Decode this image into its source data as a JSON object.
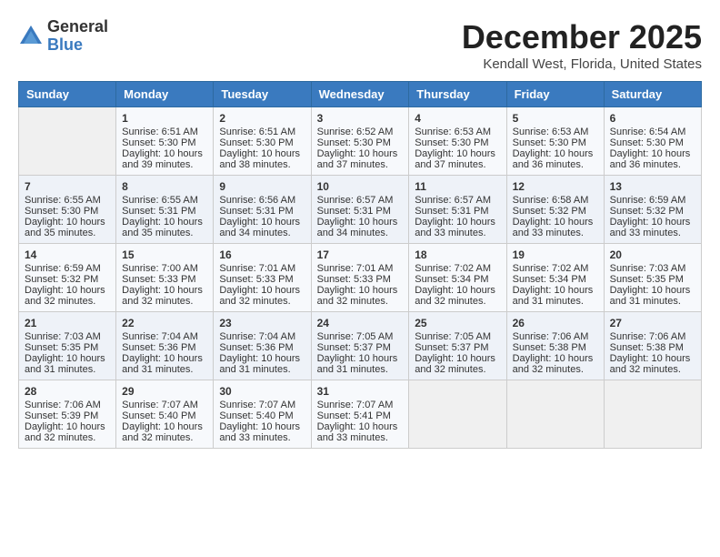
{
  "header": {
    "logo": {
      "general": "General",
      "blue": "Blue"
    },
    "title": "December 2025",
    "location": "Kendall West, Florida, United States"
  },
  "days_of_week": [
    "Sunday",
    "Monday",
    "Tuesday",
    "Wednesday",
    "Thursday",
    "Friday",
    "Saturday"
  ],
  "weeks": [
    [
      {
        "day": "",
        "content": ""
      },
      {
        "day": "1",
        "content": "Sunrise: 6:51 AM\nSunset: 5:30 PM\nDaylight: 10 hours\nand 39 minutes."
      },
      {
        "day": "2",
        "content": "Sunrise: 6:51 AM\nSunset: 5:30 PM\nDaylight: 10 hours\nand 38 minutes."
      },
      {
        "day": "3",
        "content": "Sunrise: 6:52 AM\nSunset: 5:30 PM\nDaylight: 10 hours\nand 37 minutes."
      },
      {
        "day": "4",
        "content": "Sunrise: 6:53 AM\nSunset: 5:30 PM\nDaylight: 10 hours\nand 37 minutes."
      },
      {
        "day": "5",
        "content": "Sunrise: 6:53 AM\nSunset: 5:30 PM\nDaylight: 10 hours\nand 36 minutes."
      },
      {
        "day": "6",
        "content": "Sunrise: 6:54 AM\nSunset: 5:30 PM\nDaylight: 10 hours\nand 36 minutes."
      }
    ],
    [
      {
        "day": "7",
        "content": "Sunrise: 6:55 AM\nSunset: 5:30 PM\nDaylight: 10 hours\nand 35 minutes."
      },
      {
        "day": "8",
        "content": "Sunrise: 6:55 AM\nSunset: 5:31 PM\nDaylight: 10 hours\nand 35 minutes."
      },
      {
        "day": "9",
        "content": "Sunrise: 6:56 AM\nSunset: 5:31 PM\nDaylight: 10 hours\nand 34 minutes."
      },
      {
        "day": "10",
        "content": "Sunrise: 6:57 AM\nSunset: 5:31 PM\nDaylight: 10 hours\nand 34 minutes."
      },
      {
        "day": "11",
        "content": "Sunrise: 6:57 AM\nSunset: 5:31 PM\nDaylight: 10 hours\nand 33 minutes."
      },
      {
        "day": "12",
        "content": "Sunrise: 6:58 AM\nSunset: 5:32 PM\nDaylight: 10 hours\nand 33 minutes."
      },
      {
        "day": "13",
        "content": "Sunrise: 6:59 AM\nSunset: 5:32 PM\nDaylight: 10 hours\nand 33 minutes."
      }
    ],
    [
      {
        "day": "14",
        "content": "Sunrise: 6:59 AM\nSunset: 5:32 PM\nDaylight: 10 hours\nand 32 minutes."
      },
      {
        "day": "15",
        "content": "Sunrise: 7:00 AM\nSunset: 5:33 PM\nDaylight: 10 hours\nand 32 minutes."
      },
      {
        "day": "16",
        "content": "Sunrise: 7:01 AM\nSunset: 5:33 PM\nDaylight: 10 hours\nand 32 minutes."
      },
      {
        "day": "17",
        "content": "Sunrise: 7:01 AM\nSunset: 5:33 PM\nDaylight: 10 hours\nand 32 minutes."
      },
      {
        "day": "18",
        "content": "Sunrise: 7:02 AM\nSunset: 5:34 PM\nDaylight: 10 hours\nand 32 minutes."
      },
      {
        "day": "19",
        "content": "Sunrise: 7:02 AM\nSunset: 5:34 PM\nDaylight: 10 hours\nand 31 minutes."
      },
      {
        "day": "20",
        "content": "Sunrise: 7:03 AM\nSunset: 5:35 PM\nDaylight: 10 hours\nand 31 minutes."
      }
    ],
    [
      {
        "day": "21",
        "content": "Sunrise: 7:03 AM\nSunset: 5:35 PM\nDaylight: 10 hours\nand 31 minutes."
      },
      {
        "day": "22",
        "content": "Sunrise: 7:04 AM\nSunset: 5:36 PM\nDaylight: 10 hours\nand 31 minutes."
      },
      {
        "day": "23",
        "content": "Sunrise: 7:04 AM\nSunset: 5:36 PM\nDaylight: 10 hours\nand 31 minutes."
      },
      {
        "day": "24",
        "content": "Sunrise: 7:05 AM\nSunset: 5:37 PM\nDaylight: 10 hours\nand 31 minutes."
      },
      {
        "day": "25",
        "content": "Sunrise: 7:05 AM\nSunset: 5:37 PM\nDaylight: 10 hours\nand 32 minutes."
      },
      {
        "day": "26",
        "content": "Sunrise: 7:06 AM\nSunset: 5:38 PM\nDaylight: 10 hours\nand 32 minutes."
      },
      {
        "day": "27",
        "content": "Sunrise: 7:06 AM\nSunset: 5:38 PM\nDaylight: 10 hours\nand 32 minutes."
      }
    ],
    [
      {
        "day": "28",
        "content": "Sunrise: 7:06 AM\nSunset: 5:39 PM\nDaylight: 10 hours\nand 32 minutes."
      },
      {
        "day": "29",
        "content": "Sunrise: 7:07 AM\nSunset: 5:40 PM\nDaylight: 10 hours\nand 32 minutes."
      },
      {
        "day": "30",
        "content": "Sunrise: 7:07 AM\nSunset: 5:40 PM\nDaylight: 10 hours\nand 33 minutes."
      },
      {
        "day": "31",
        "content": "Sunrise: 7:07 AM\nSunset: 5:41 PM\nDaylight: 10 hours\nand 33 minutes."
      },
      {
        "day": "",
        "content": ""
      },
      {
        "day": "",
        "content": ""
      },
      {
        "day": "",
        "content": ""
      }
    ]
  ]
}
